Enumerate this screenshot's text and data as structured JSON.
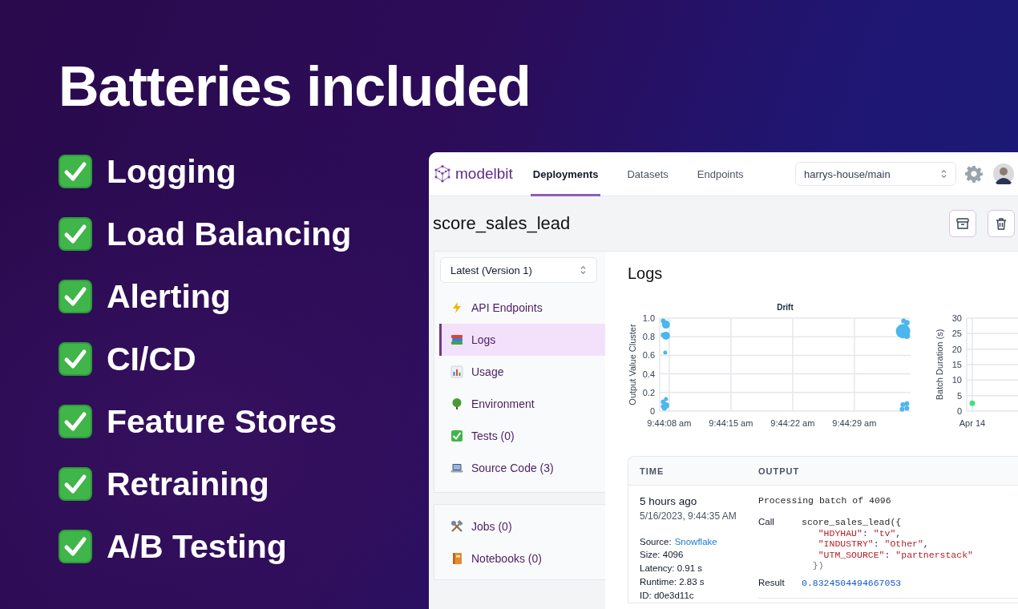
{
  "headline": "Batteries included",
  "features": [
    {
      "label": "Logging",
      "checked": true
    },
    {
      "label": "Load Balancing",
      "checked": true
    },
    {
      "label": "Alerting",
      "checked": true
    },
    {
      "label": "CI/CD",
      "checked": true
    },
    {
      "label": "Feature Stores",
      "checked": true
    },
    {
      "label": "Retraining",
      "checked": true
    },
    {
      "label": "A/B Testing",
      "checked": true
    }
  ],
  "app": {
    "logo": "modelbit",
    "tabs": [
      {
        "label": "Deployments",
        "selected": true
      },
      {
        "label": "Datasets",
        "selected": false
      },
      {
        "label": "Endpoints",
        "selected": false
      }
    ],
    "workspace_select": {
      "value": "harrys-house/main"
    },
    "deployment_title": "score_sales_lead",
    "version_select": {
      "value": "Latest (Version 1)"
    },
    "nav_groups": [
      [
        {
          "label": "API Endpoints",
          "kind": "endpoints",
          "selected": false
        },
        {
          "label": "Logs",
          "kind": "logs",
          "selected": true
        },
        {
          "label": "Usage",
          "kind": "usage",
          "selected": false
        },
        {
          "label": "Environment",
          "kind": "environment",
          "selected": false
        },
        {
          "label": "Tests (0)",
          "kind": "tests",
          "selected": false
        },
        {
          "label": "Source Code (3)",
          "kind": "source",
          "selected": false
        }
      ],
      [
        {
          "label": "Jobs (0)",
          "kind": "jobs",
          "selected": false
        },
        {
          "label": "Notebooks (0)",
          "kind": "notebooks",
          "selected": false
        }
      ]
    ],
    "logs": {
      "title": "Logs",
      "drift": {
        "title": "Drift",
        "y_label": "Output Value Cluster",
        "y_ticks": [
          "1.0",
          "0.8",
          "0.6",
          "0.4",
          "0.2",
          "0"
        ],
        "x_ticks": [
          "9:44:08 am",
          "9:44:15 am",
          "9:44:22 am",
          "9:44:29 am"
        ]
      },
      "charts": [
        {
          "chart_data": {
            "type": "scatter",
            "ylabel": "Batch Duration (s)",
            "categories": [
              "Apr 14"
            ],
            "series": [
              {
                "color": "#4ade80",
                "values": [
                  2.5
                ]
              }
            ],
            "ylim": [
              0,
              30
            ],
            "grid": true,
            "yticks": [
              0,
              5,
              10,
              15,
              20,
              25,
              30
            ]
          }
        }
      ]
    },
    "table": {
      "columns": [
        "TIME",
        "OUTPUT"
      ],
      "rows": [
        {
          "relative_time": "5 hours ago",
          "timestamp": "5/16/2023, 9:44:35 AM",
          "source_label": "Source:",
          "source": "Snowflake",
          "details": [
            "Size: 4096",
            "Latency: 0.91 s",
            "Runtime: 2.83 s",
            "ID: d0e3d11c"
          ],
          "message": "Processing batch of 4096",
          "call_label": "Call",
          "call_lines": [
            [
              {
                "text": "score_sales_lead({",
                "kind": "plain"
              }
            ],
            [
              {
                "text": "   \"HDYHAU\"",
                "kind": "string"
              },
              {
                "text": ": ",
                "kind": "plain"
              },
              {
                "text": "\"tv\"",
                "kind": "string"
              },
              {
                "text": ",",
                "kind": "plain"
              }
            ],
            [
              {
                "text": "   \"INDUSTRY\"",
                "kind": "string"
              },
              {
                "text": ": ",
                "kind": "plain"
              },
              {
                "text": "\"Other\"",
                "kind": "string"
              },
              {
                "text": ",",
                "kind": "plain"
              }
            ],
            [
              {
                "text": "   \"UTM_SOURCE\"",
                "kind": "string"
              },
              {
                "text": ": ",
                "kind": "plain"
              },
              {
                "text": "\"partnerstack\"",
                "kind": "string"
              }
            ],
            [
              {
                "text": "  })",
                "kind": "muted"
              }
            ]
          ],
          "result_label": "Result",
          "result": "0.8324504494667053"
        }
      ]
    }
  }
}
